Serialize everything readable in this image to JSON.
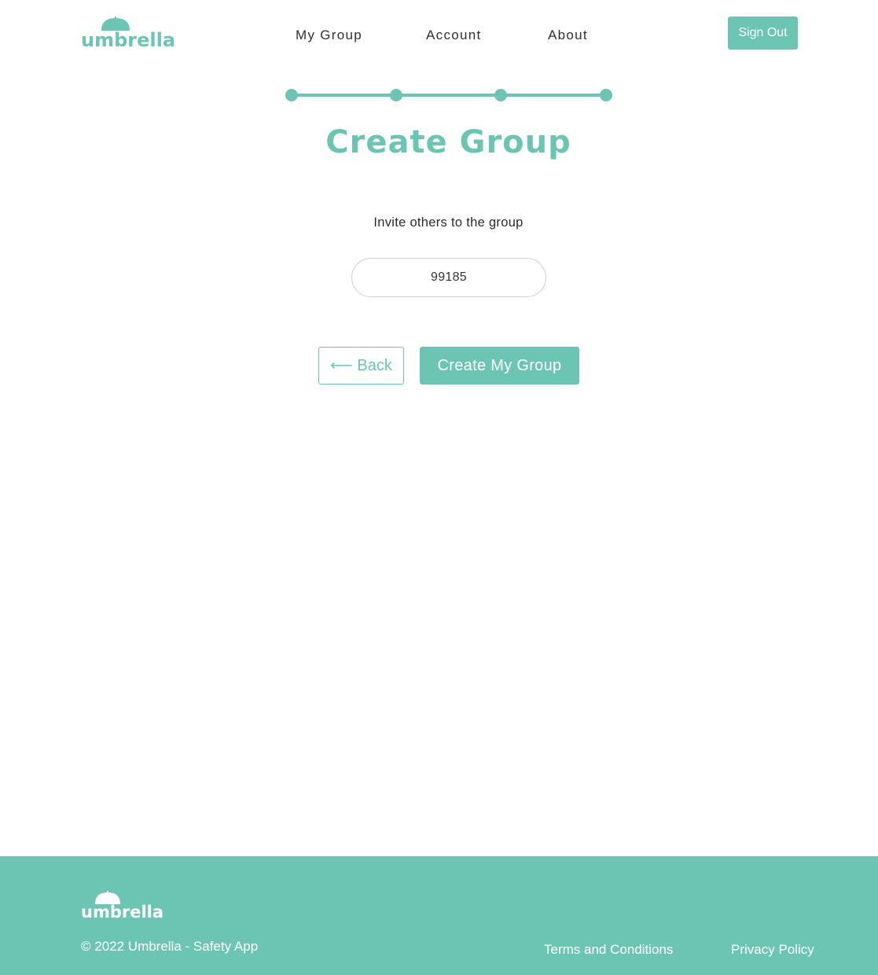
{
  "brand": {
    "name": "umbrella"
  },
  "nav": {
    "items": [
      "My Group",
      "Account",
      "About"
    ],
    "signout_label": "Sign Out"
  },
  "stepper": {
    "total_steps": 4,
    "completed_steps": 4
  },
  "main": {
    "title": "Create Group",
    "subtitle": "Invite others to the group",
    "group_code": "99185",
    "back_label": "⟵ Back",
    "create_label": "Create My Group"
  },
  "footer": {
    "brand": "umbrella",
    "copyright": "© 2022 Umbrella - Safety App",
    "terms_label": "Terms and Conditions",
    "privacy_label": "Privacy Policy"
  },
  "colors": {
    "accent": "#6cc4b2",
    "text": "#2b2b2b",
    "background": "#ffffff"
  }
}
